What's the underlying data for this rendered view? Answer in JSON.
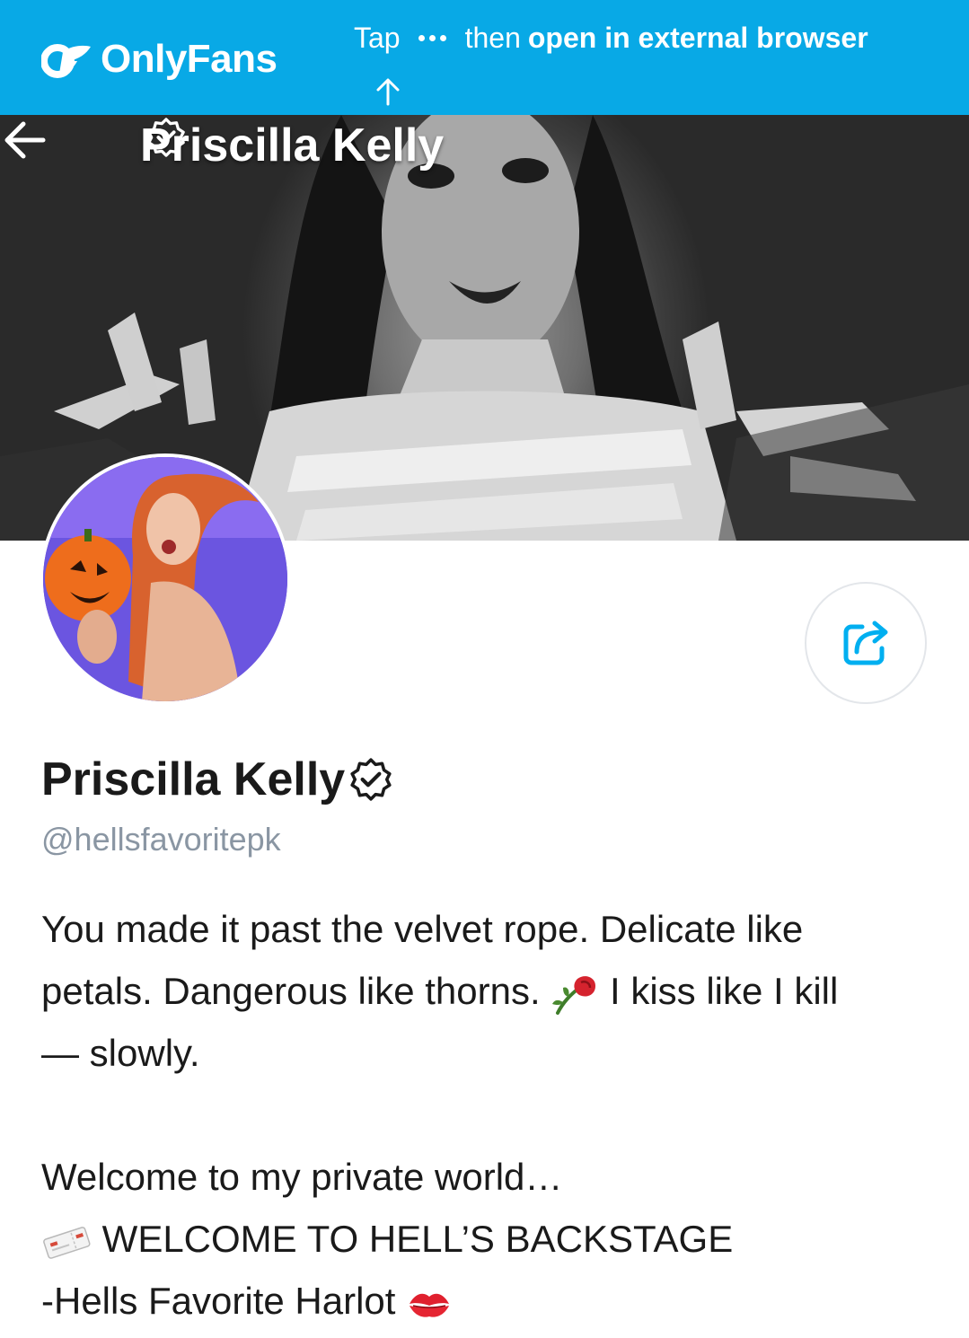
{
  "banner": {
    "brand_name": "OnlyFans",
    "hint_tap": "Tap",
    "hint_then": "then",
    "hint_action": "open in external browser",
    "color": "#08a9e6"
  },
  "header": {
    "title": "Priscilla Kelly",
    "back_icon": "arrow-left-icon",
    "verified_icon": "verified-badge-icon"
  },
  "profile": {
    "name": "Priscilla Kelly",
    "handle": "@hellsfavoritepk",
    "share_icon": "share-icon",
    "accent": "#00aff0",
    "muted": "#8a96a3"
  },
  "bio": {
    "line1": "You made it past the velvet rope. Delicate like",
    "line2a": "petals. Dangerous like thorns.",
    "line2b": "I kiss like I kill",
    "line3": "— slowly.",
    "line4": "Welcome to my private world…",
    "line5": "WELCOME TO HELL’S BACKSTAGE",
    "line6": "-Hells Favorite Harlot",
    "emoji_rose": "wilted-rose-icon",
    "emoji_ticket": "ticket-icon",
    "emoji_kiss": "kiss-mark-icon"
  }
}
